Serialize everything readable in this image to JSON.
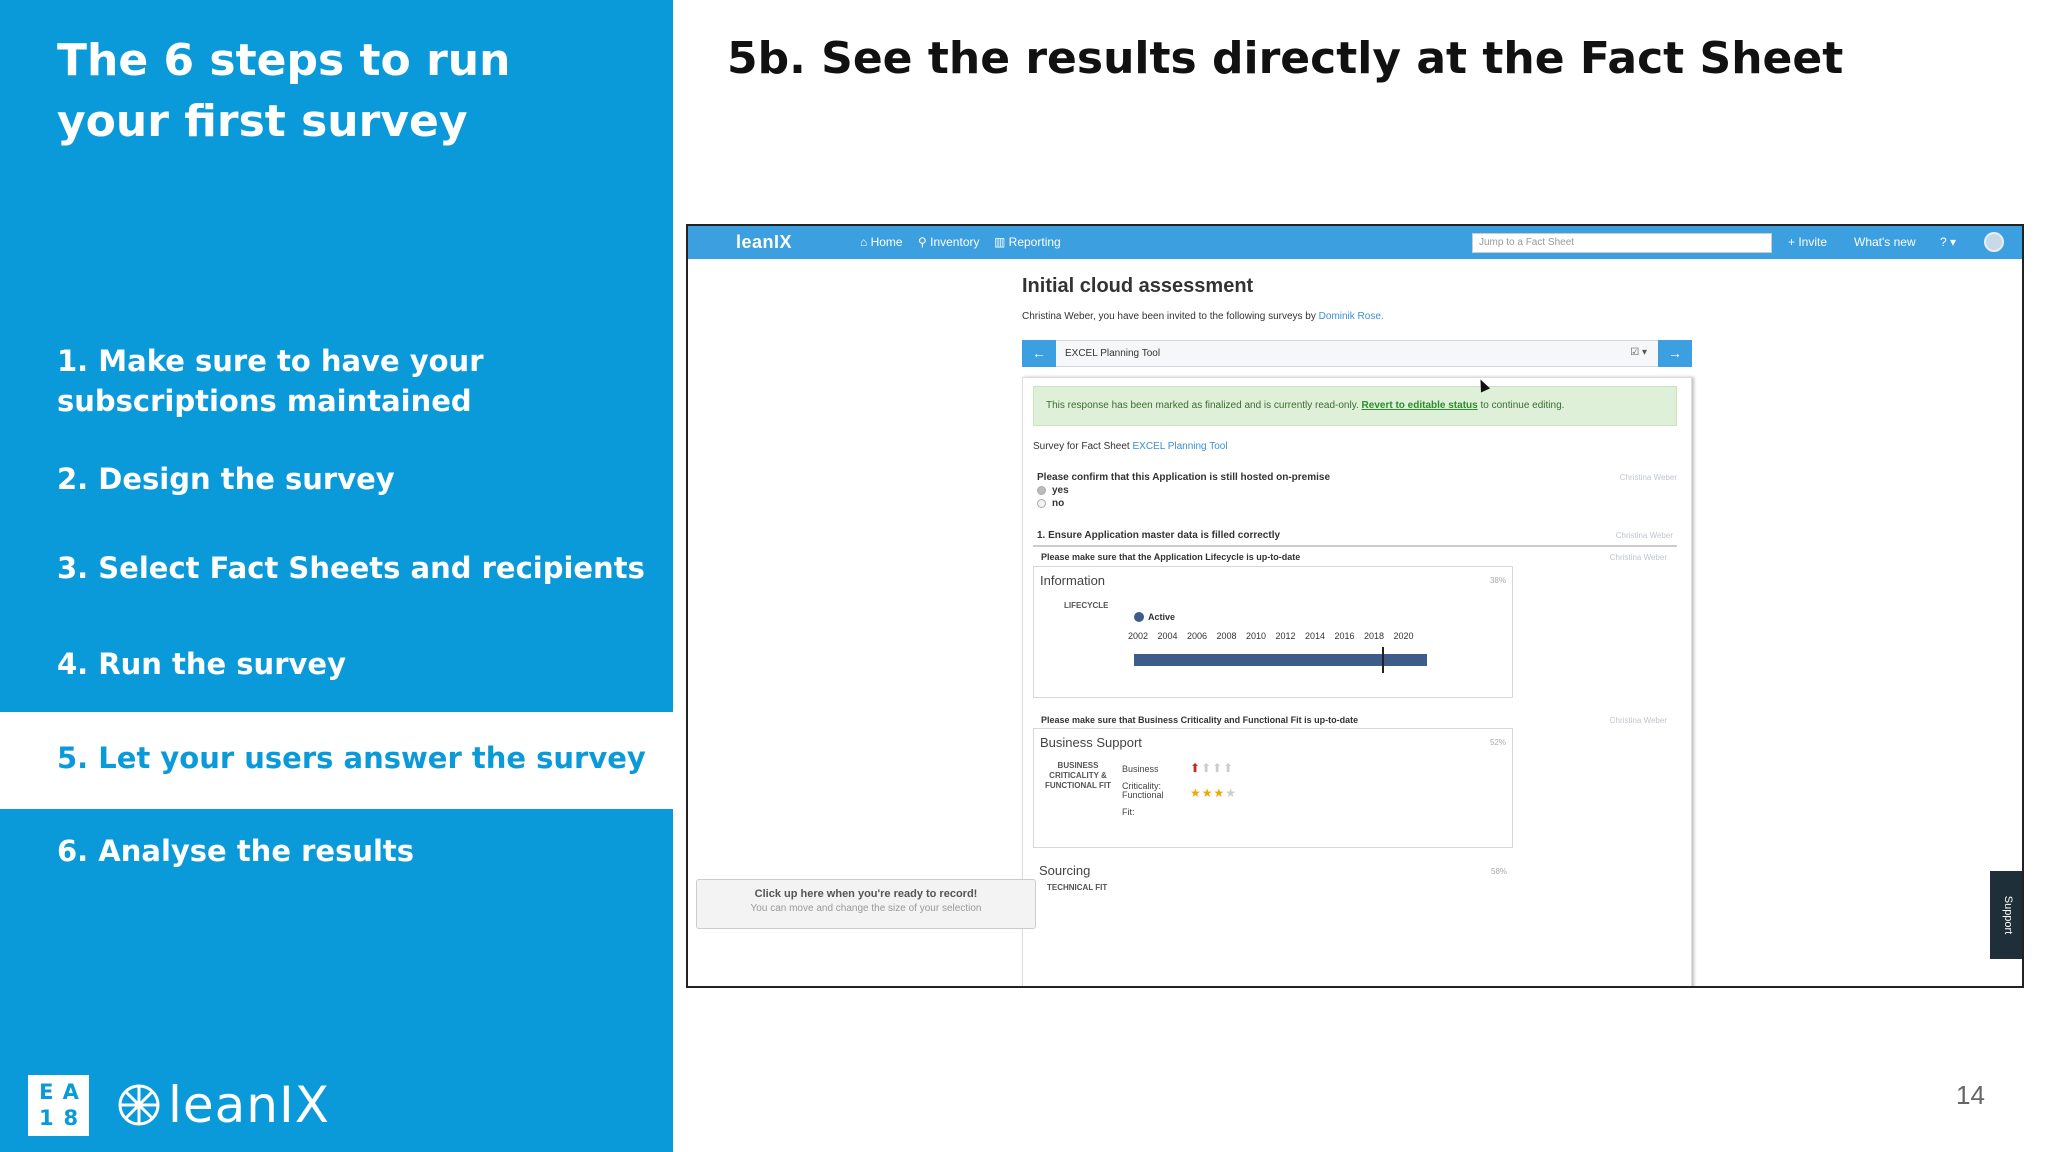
{
  "left_panel": {
    "title": "The 6 steps to run your first survey",
    "steps": [
      "1. Make sure to have your subscriptions maintained",
      "2. Design the survey",
      "3. Select Fact Sheets and recipients",
      "4. Run the survey",
      "5. Let your users answer the survey",
      "6. Analyse the results"
    ],
    "active_step_index": 4,
    "badge_letters": [
      "E",
      "A",
      "1",
      "8"
    ],
    "logo_text": "leanIX"
  },
  "slide_title": "5b. See the results directly at the Fact Sheet",
  "page_number": "14",
  "colors": {
    "panel_blue": "#0a9ad9",
    "app_nav_blue": "#3b9fe0",
    "lifecycle_bar": "#3e5c8a",
    "alert_bg": "#dff0d8"
  },
  "app": {
    "brand": "leanIX",
    "nav": {
      "home": "Home",
      "inventory": "Inventory",
      "reporting": "Reporting",
      "search_placeholder": "Jump to a Fact Sheet",
      "invite": "+ Invite",
      "whats_new": "What's new",
      "help": "? ▾"
    },
    "survey_title": "Initial cloud assessment",
    "invite_text": "Christina Weber, you have been invited to the following surveys by ",
    "invite_author": "Dominik Rose.",
    "selector": {
      "prev": "←",
      "next": "→",
      "value": "EXCEL Planning Tool",
      "icons": "☑ ▾"
    },
    "alert": {
      "text_before": "This response has been marked as finalized and is currently read-only. ",
      "link": "Revert to editable status",
      "text_after": " to continue editing."
    },
    "fact_sheet_line": "Survey for Fact Sheet ",
    "fact_sheet_link": "EXCEL Planning Tool",
    "question1": "Please confirm that this Application is still hosted on-premise",
    "answer_author": "Christina Weber",
    "options": [
      "yes",
      "no"
    ],
    "section1": "1. Ensure Application master data is filled correctly",
    "lifecycle_question": "Please make sure that the Application Lifecycle is up-to-date",
    "information": {
      "title": "Information",
      "percent": "38%",
      "lifecycle_label": "LIFECYCLE",
      "legend": "Active",
      "years": [
        "2002",
        "2004",
        "2006",
        "2008",
        "2010",
        "2012",
        "2014",
        "2016",
        "2018",
        "2020"
      ]
    },
    "criticality_question": "Please make sure that Business Criticality and Functional Fit is up-to-date",
    "business_support": {
      "title": "Business Support",
      "percent": "52%",
      "label": "BUSINESS CRITICALITY & FUNCTIONAL FIT",
      "criticality_label": "Business Criticality:",
      "criticality_level": "1 of 4",
      "fit_label": "Functional Fit:",
      "fit_level": "3 of 4"
    },
    "sourcing": {
      "title": "Sourcing",
      "percent": "58%",
      "label": "TECHNICAL FIT"
    },
    "tooltip": {
      "line1": "Click up here when you're ready to record!",
      "line2": "You can move and change the size of your selection"
    },
    "support": "Support"
  }
}
